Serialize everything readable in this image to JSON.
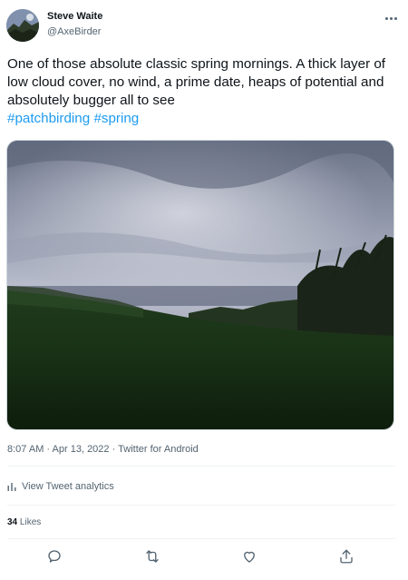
{
  "author": {
    "name": "Steve Waite",
    "handle": "@AxeBirder"
  },
  "tweet": {
    "text": "One of those absolute classic spring mornings. A thick layer of low cloud cover, no wind, a prime date, heaps of potential and absolutely bugger all to see",
    "hashtags": [
      "#patchbirding",
      "#spring"
    ]
  },
  "meta": {
    "time": "8:07 AM",
    "separator": "·",
    "date": "Apr 13, 2022",
    "source": "Twitter for Android"
  },
  "analytics": {
    "label": "View Tweet analytics",
    "icon": "analytics-bars-icon"
  },
  "likes": {
    "count": "34",
    "label": "Likes"
  },
  "actions": {
    "icons": [
      "reply-icon",
      "retweet-icon",
      "like-icon",
      "share-icon"
    ]
  },
  "colors": {
    "link": "#1d9bf0",
    "text": "#0f1419",
    "secondary": "#536471"
  }
}
